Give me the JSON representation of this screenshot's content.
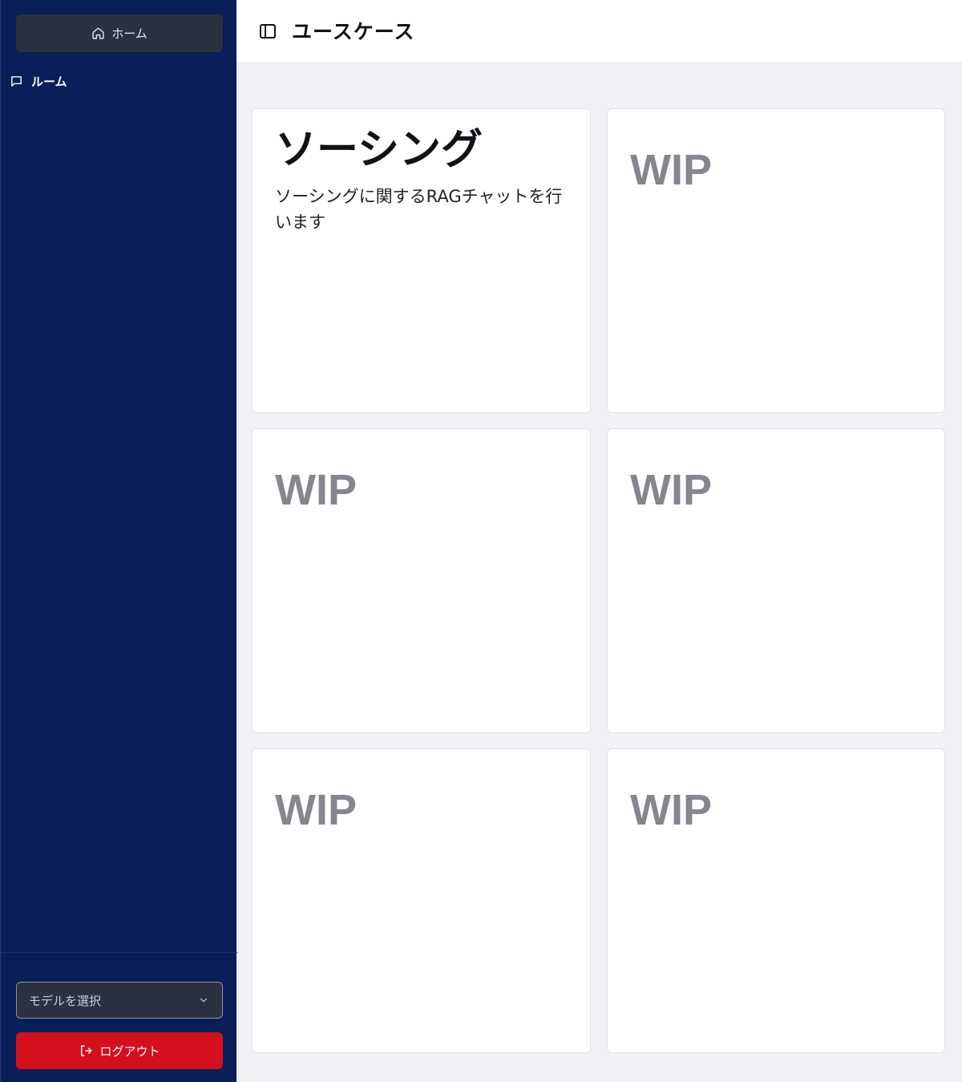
{
  "sidebar": {
    "home_label": "ホーム",
    "room_label": "ルーム",
    "model_select_placeholder": "モデルを選択",
    "logout_label": "ログアウト"
  },
  "header": {
    "title": "ユースケース"
  },
  "cards": [
    {
      "title": "ソーシング",
      "description": "ソーシングに関するRAGチャットを行います"
    },
    {
      "title": "WIP"
    },
    {
      "title": "WIP"
    },
    {
      "title": "WIP"
    },
    {
      "title": "WIP"
    },
    {
      "title": "WIP"
    }
  ],
  "colors": {
    "sidebar_bg": "#0a1e58",
    "logout_bg": "#d40f1e",
    "page_bg": "#f0f1f4",
    "wip_text": "#85868e"
  },
  "icons": {
    "home": "home-icon",
    "room": "chat-bubble-icon",
    "select": "chevron-down-icon",
    "logout": "logout-icon",
    "sidebar_toggle": "sidebar-toggle-icon"
  }
}
